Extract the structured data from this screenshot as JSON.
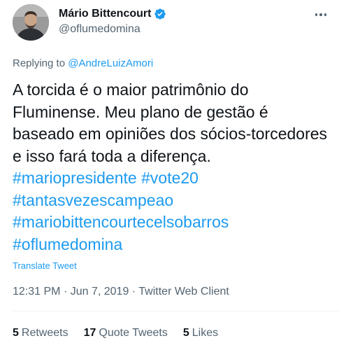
{
  "author": {
    "display_name": "Mário Bittencourt",
    "handle": "@oflumedomina"
  },
  "reply": {
    "prefix": "Replying to",
    "to": "@AndreLuizAmori"
  },
  "text": {
    "main": "A torcida é o maior patrimônio do Fluminense. Meu plano de gestão é baseado em opiniões dos sócios-torcedores e isso fará toda a diferença.",
    "hashtags": [
      "#mariopresidente",
      "#vote20",
      "#tantasvezescampeao",
      "#mariobittencourtecelsobarros",
      "#oflumedomina"
    ]
  },
  "translate_label": "Translate Tweet",
  "meta": {
    "time": "12:31 PM",
    "date": "Jun 7, 2019",
    "client": "Twitter Web Client"
  },
  "stats": {
    "retweets_count": "5",
    "retweets_label": "Retweets",
    "quotes_count": "17",
    "quotes_label": "Quote Tweets",
    "likes_count": "5",
    "likes_label": "Likes"
  },
  "colors": {
    "link": "#1d9bf0",
    "secondary_text": "#536471",
    "primary_text": "#0f1419"
  },
  "icons": [
    "verified-badge-icon",
    "more-options-icon"
  ]
}
